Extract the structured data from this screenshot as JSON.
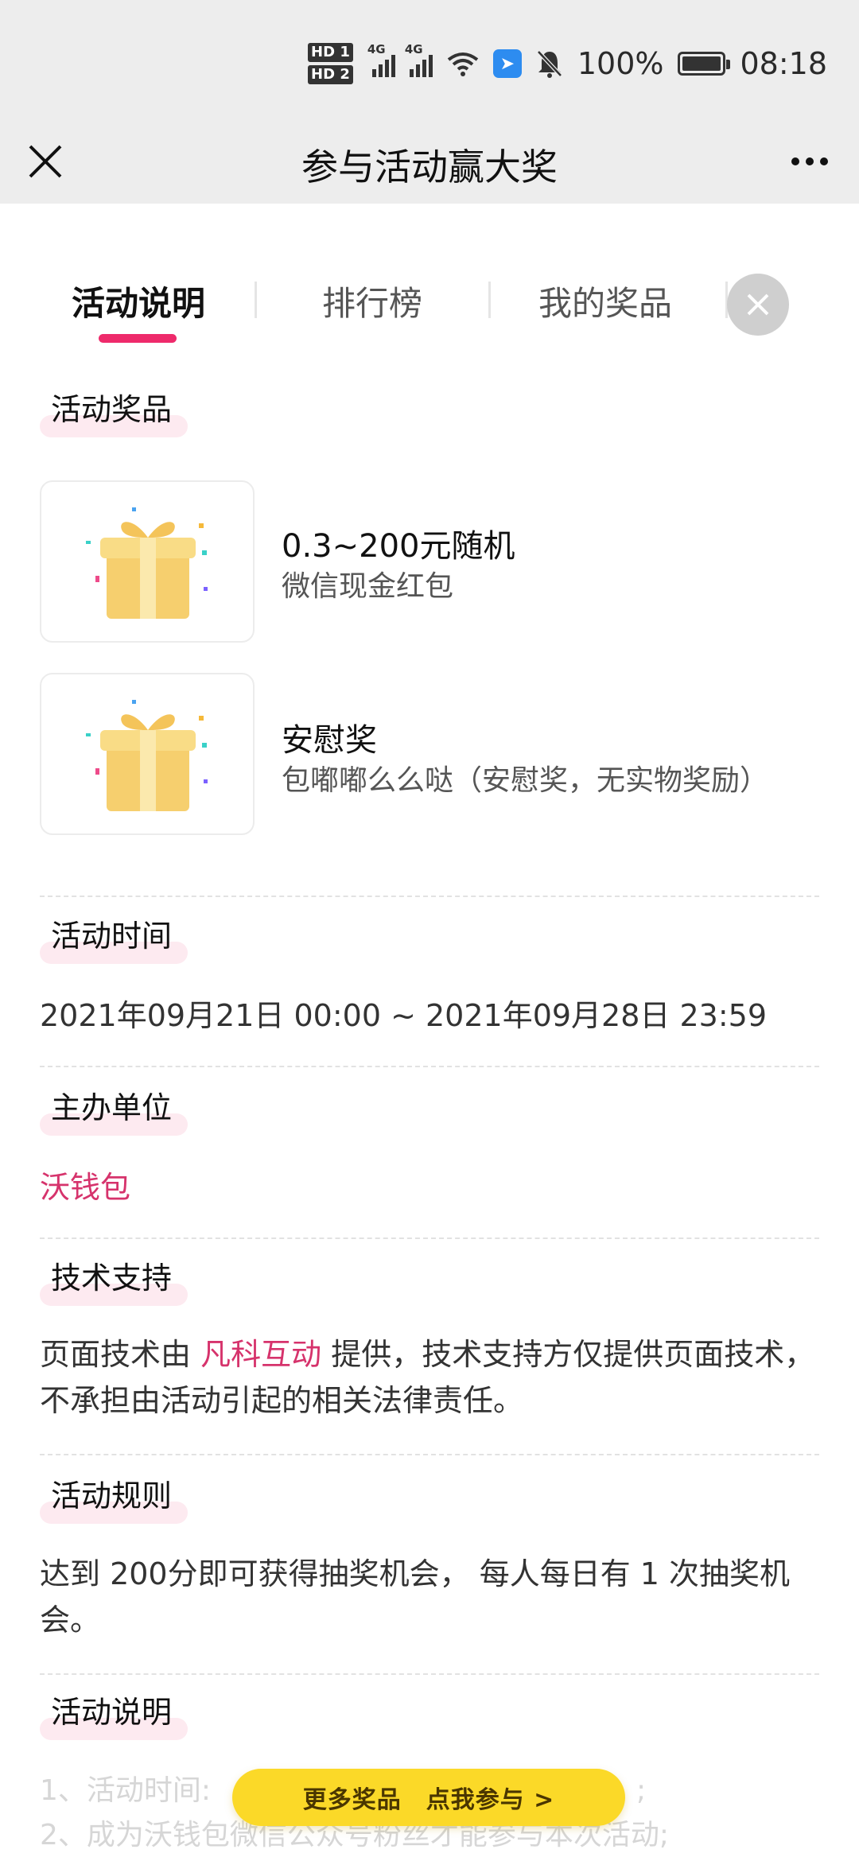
{
  "status_bar": {
    "signal_label_1": "4G",
    "signal_label_2": "4G",
    "hd1": "HD 1",
    "hd2": "HD 2",
    "battery": "100%",
    "time": "08:18"
  },
  "header": {
    "title": "参与活动赢大奖"
  },
  "tabs": {
    "items": [
      {
        "label": "活动说明"
      },
      {
        "label": "排行榜"
      },
      {
        "label": "我的奖品"
      }
    ]
  },
  "sections": {
    "prizes_title": "活动奖品",
    "prizes": [
      {
        "name": "0.3~200元随机",
        "desc": "微信现金红包"
      },
      {
        "name": "安慰奖",
        "desc": "包嘟嘟么么哒（安慰奖，无实物奖励）"
      }
    ],
    "time_title": "活动时间",
    "time_value": "2021年09月21日 00:00 ~ 2021年09月28日 23:59",
    "organizer_title": "主办单位",
    "organizer_value": "沃钱包",
    "tech_title": "技术支持",
    "tech_prefix": "页面技术由 ",
    "tech_link": "凡科互动",
    "tech_suffix": " 提供，技术支持方仅提供页面技术，不承担由活动引起的相关法律责任。",
    "rules_title": "活动规则",
    "rules_value": "达到 200分即可获得抽奖机会， 每人每日有 1 次抽奖机会。",
    "desc_title": "活动说明",
    "desc_line1_a": "1、活动时间:",
    "desc_line1_b": ";",
    "desc_line2": "2、成为沃钱包微信公众号粉丝才能参与本次活动;"
  },
  "cta": {
    "label": "更多奖品　点我参与 >"
  },
  "colors": {
    "accent_pink": "#ee2a6b",
    "link_pink": "#d6336c",
    "cta_yellow": "#fbd928",
    "header_bg": "#ededed"
  }
}
